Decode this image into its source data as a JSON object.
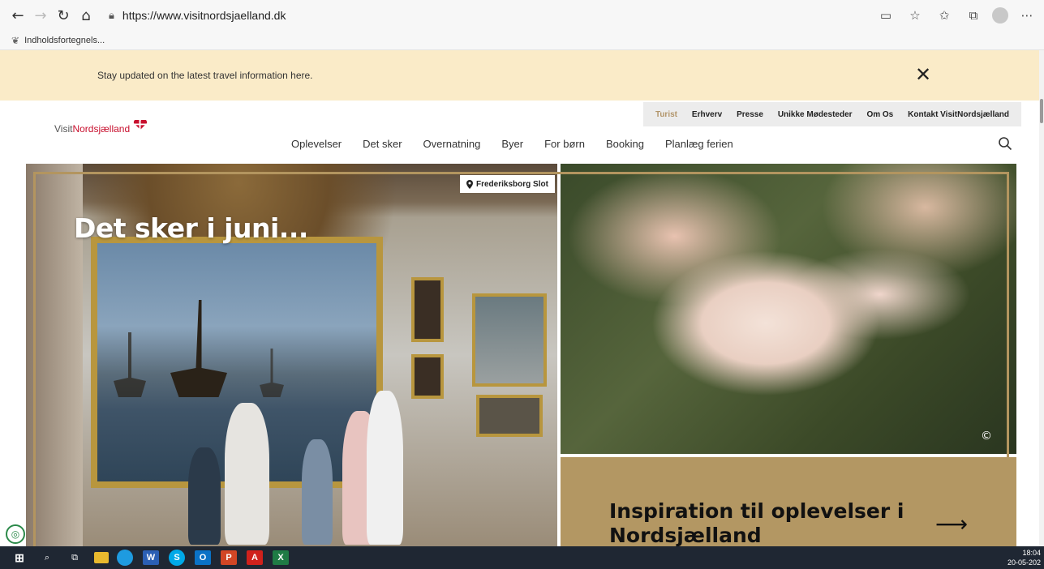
{
  "browser": {
    "url": "https://www.visitnordsjaelland.dk",
    "favorite_label": "Indholdsfortegnels..."
  },
  "notice": {
    "text": "Stay updated on the latest travel information here."
  },
  "logo": {
    "visit": "Visit",
    "brand": "Nordsjælland"
  },
  "topnav": [
    {
      "label": "Turist",
      "active": true
    },
    {
      "label": "Erhverv"
    },
    {
      "label": "Presse"
    },
    {
      "label": "Unikke Mødesteder"
    },
    {
      "label": "Om Os"
    },
    {
      "label": "Kontakt VisitNordsjælland"
    }
  ],
  "mainnav": [
    "Oplevelser",
    "Det sker",
    "Overnatning",
    "Byer",
    "For børn",
    "Booking",
    "Planlæg ferien"
  ],
  "hero": {
    "title": "Det sker i juni...",
    "location": "Frederiksborg Slot",
    "copyright_symbol": "©"
  },
  "inspiration": {
    "title": "Inspiration til oplevelser i Nordsjælland",
    "arrow": "⟶"
  },
  "taskbar": {
    "time": "18:04",
    "date": "20-05-202"
  },
  "colors": {
    "notice_bg": "#faebc8",
    "gold": "#b3955f",
    "brand_red": "#c8102e"
  }
}
